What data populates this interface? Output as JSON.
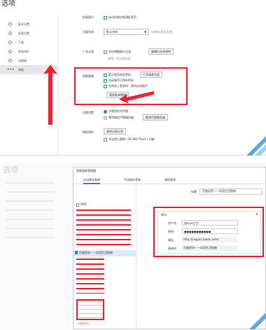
{
  "top": {
    "title": "选项",
    "sidebar": [
      {
        "icon": "gear-icon",
        "label": "基本设置"
      },
      {
        "icon": "tag-icon",
        "label": "标签设置"
      },
      {
        "icon": "download-icon",
        "label": "下载"
      },
      {
        "icon": "shield-icon",
        "label": "隐私保护"
      },
      {
        "icon": "target-icon",
        "label": "快捷键"
      },
      {
        "icon": "more-icon",
        "label": "高级"
      }
    ],
    "rows": {
      "frame": {
        "label": "框架窗口",
        "opt": "启动时前往新建标签页"
      },
      "font": {
        "label": "页面字体",
        "value": "默认字体",
        "hint": "(对新标签页生效)"
      },
      "adblock": {
        "label": "广告过滤",
        "opt1": "启动弹窗窗口过滤",
        "btn": "编辑白名单规则",
        "hint": "使用广告过滤功能"
      },
      "smartfill": {
        "label": "智能填表",
        "opt1": "提示是否保存密码",
        "btn": "打开填表列表",
        "opt2": "自动填写已保存密码",
        "opt3": "在网站上登录时，使用自动填写",
        "btn2": "管理表单数据"
      },
      "proxy": {
        "label": "代理设置",
        "opt1": "不使用任何代理",
        "opt2": "使用指定代理服务器",
        "btn": "更改代理服务器"
      },
      "privacy": {
        "label": "隐私保护",
        "btn": "清除无痕记录",
        "opt": "开启禁止跟踪 ( Do Not Track ) 功能"
      }
    }
  },
  "bottom": {
    "title": "选项",
    "dialog_title": "智能填表管理器",
    "tabs": [
      "自动保存表单",
      "手动保存表单",
      "通用表单"
    ],
    "list_item": "DM1",
    "selected_item": "百度经验——实用生活指南",
    "entry_label": "标题",
    "entry_value": "百度经验——实用生活指南",
    "account": {
      "header": "账号",
      "username_label": "用户名",
      "username": "周love打字",
      "password_label": "密码",
      "password": "●●●●●●●●●●●",
      "site_label": "网址",
      "site": "http://jingyan.baidu.com/",
      "form_label": "表单项",
      "form": "百度经验——实用生活指南"
    },
    "footer_link": "百度经验"
  },
  "colors": {
    "red": "#e23",
    "accent": "#3a7bd5"
  }
}
